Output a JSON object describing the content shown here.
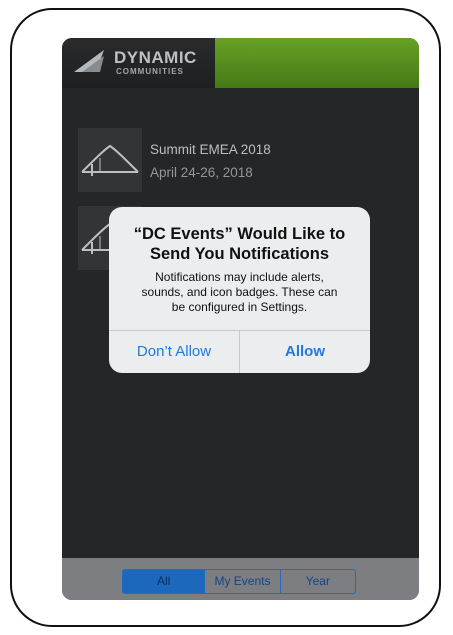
{
  "header": {
    "logo_title": "DYNAMIC",
    "logo_subtitle": "COMMUNITIES"
  },
  "events": [
    {
      "title": "Summit EMEA 2018",
      "date": "April 24-26, 2018"
    },
    {
      "title": "",
      "date": ""
    }
  ],
  "alert": {
    "title_line1": "“DC Events” Would Like to",
    "title_line2": "Send You Notifications",
    "message_line1": "Notifications may include alerts,",
    "message_line2": "sounds, and icon badges. These can",
    "message_line3": "be configured in Settings.",
    "deny_label": "Don’t Allow",
    "allow_label": "Allow"
  },
  "tabs": [
    {
      "label": "All",
      "active": true
    },
    {
      "label": "My Events",
      "active": false
    },
    {
      "label": "Year",
      "active": false
    }
  ],
  "colors": {
    "accent_green": "#76b82a",
    "ios_blue": "#1f7ae0",
    "background_dark": "#2b2c2e"
  }
}
